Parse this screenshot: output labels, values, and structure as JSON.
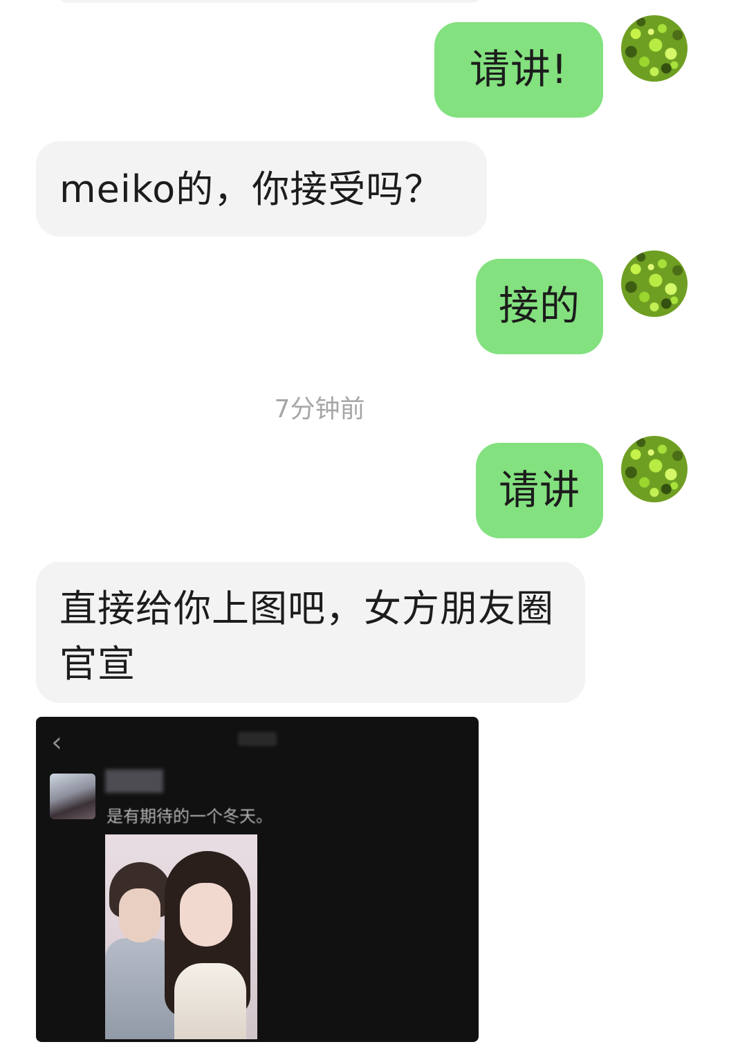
{
  "chat": {
    "messages": [
      {
        "sender": "self",
        "text": "请讲!"
      },
      {
        "sender": "other",
        "text": "meiko的，你接受吗？"
      },
      {
        "sender": "self",
        "text": "接的"
      },
      {
        "sender": "self",
        "text": "请讲"
      },
      {
        "sender": "other",
        "text": "直接给你上图吧，女方朋友圈官宣"
      }
    ],
    "timestamp": "7分钟前"
  },
  "attached_image": {
    "back_icon": "chevron-left-icon",
    "post_text": "是有期待的一个冬天。"
  },
  "colors": {
    "outgoing_bubble": "#83e17f",
    "incoming_bubble": "#f3f3f3",
    "timestamp_text": "#a6a6a6"
  }
}
